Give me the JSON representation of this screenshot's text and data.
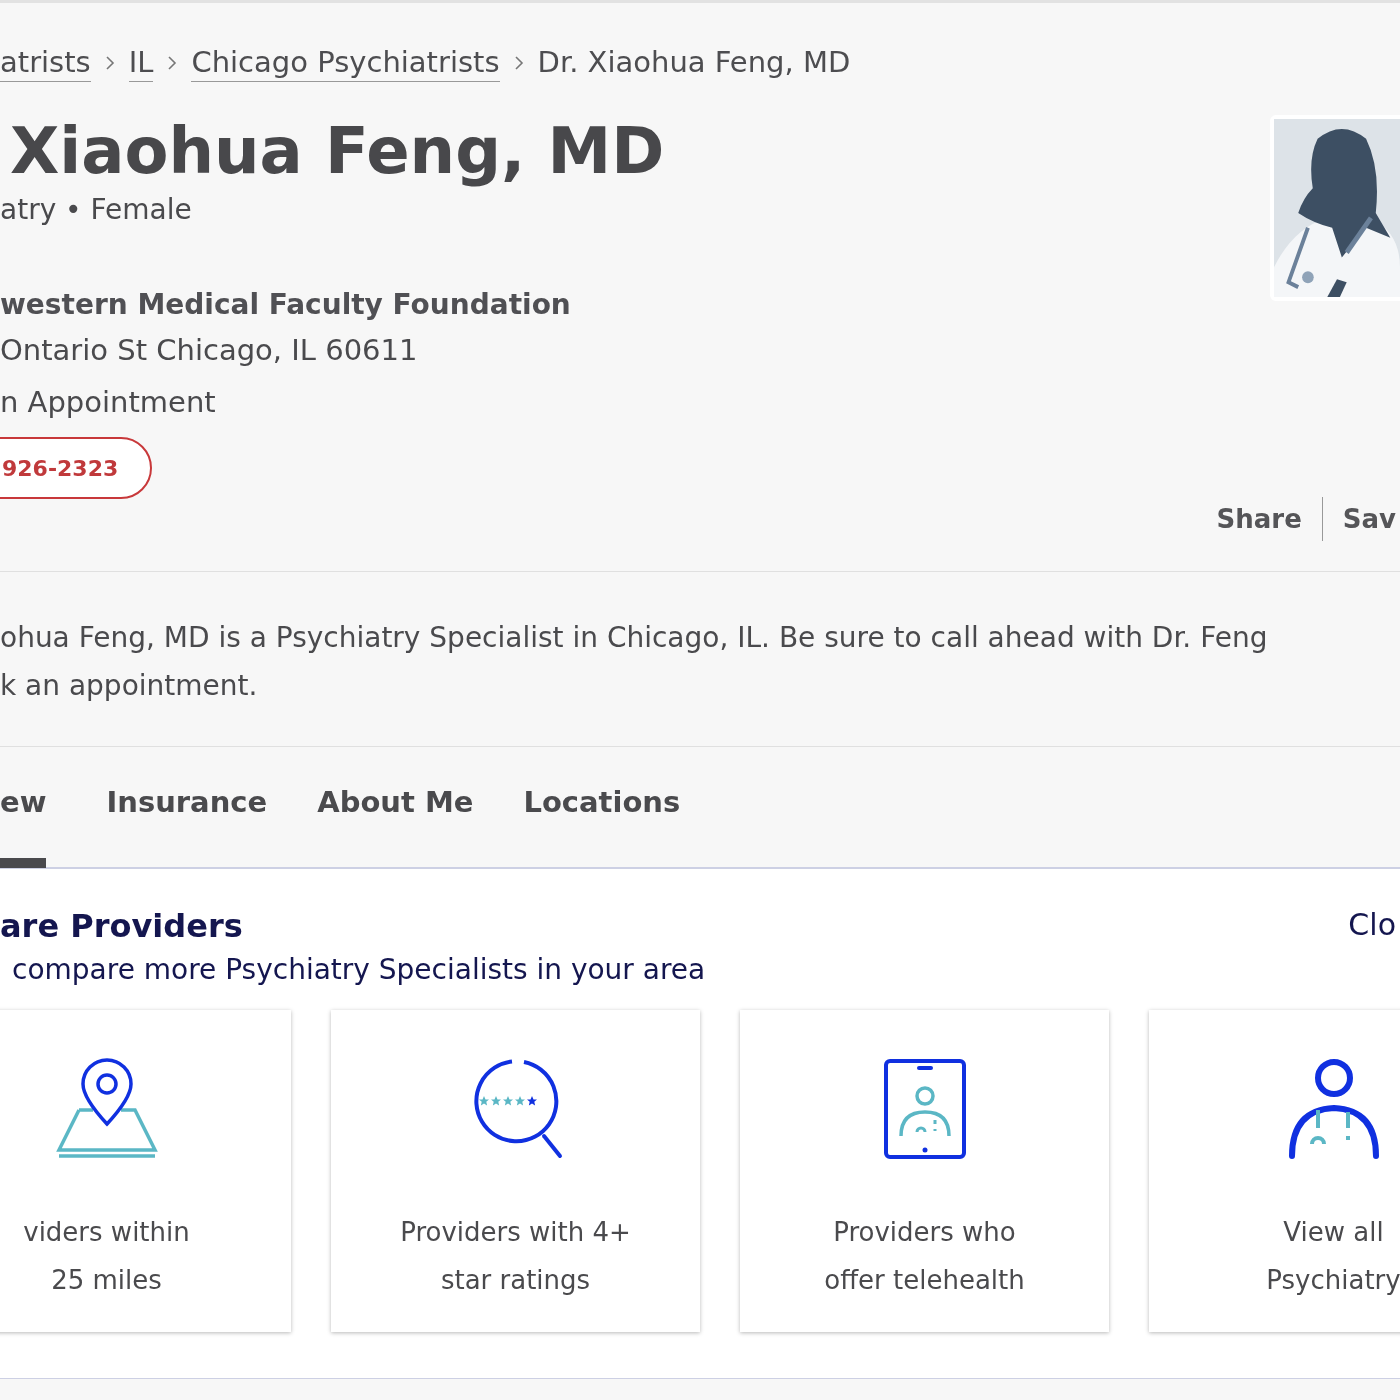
{
  "breadcrumbs": [
    {
      "label": "atrists",
      "link": true
    },
    {
      "label": "IL",
      "link": true
    },
    {
      "label": "Chicago Psychiatrists",
      "link": true
    },
    {
      "label": "Dr. Xiaohua Feng, MD",
      "link": false
    }
  ],
  "profile": {
    "name": "Xiaohua Feng, MD",
    "subtitle": "atry • Female",
    "organization": "western Medical Faculty Foundation",
    "address": "Ontario St Chicago, IL 60611",
    "appointment_note": "n Appointment",
    "phone": "926-2323"
  },
  "actions": [
    "Share",
    "Sav"
  ],
  "description": [
    "ohua Feng, MD is a Psychiatry Specialist in Chicago, IL.  Be sure to call ahead with Dr. Feng",
    "k an appointment."
  ],
  "tabs": [
    {
      "label": "ew",
      "selected": true
    },
    {
      "label": "Insurance",
      "selected": false
    },
    {
      "label": "About Me",
      "selected": false
    },
    {
      "label": "Locations",
      "selected": false
    }
  ],
  "compare": {
    "title": "are Providers",
    "subtitle": "compare more Psychiatry Specialists in your area",
    "close": "Clo",
    "cards": [
      {
        "kind": "location",
        "lines": [
          "viders within",
          "25 miles"
        ]
      },
      {
        "kind": "rating",
        "lines": [
          "Providers with 4+",
          "star ratings"
        ]
      },
      {
        "kind": "telehealth",
        "lines": [
          "Providers who",
          "offer telehealth"
        ]
      },
      {
        "kind": "specialty",
        "lines": [
          "View all",
          "Psychiatry"
        ]
      }
    ]
  }
}
